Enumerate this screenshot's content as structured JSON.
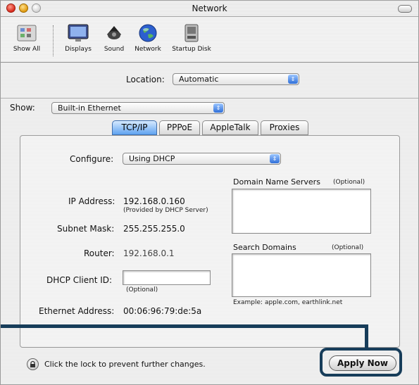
{
  "window": {
    "title": "Network"
  },
  "toolbar": {
    "show_all": "Show All",
    "items": [
      "Displays",
      "Sound",
      "Network",
      "Startup Disk"
    ]
  },
  "location": {
    "label": "Location:",
    "value": "Automatic"
  },
  "show": {
    "label": "Show:",
    "value": "Built-in Ethernet"
  },
  "tabs": [
    "TCP/IP",
    "PPPoE",
    "AppleTalk",
    "Proxies"
  ],
  "tcpip": {
    "configure_label": "Configure:",
    "configure_value": "Using DHCP",
    "ip_label": "IP Address:",
    "ip_value": "192.168.0.160",
    "ip_note": "(Provided by DHCP Server)",
    "subnet_label": "Subnet Mask:",
    "subnet_value": "255.255.255.0",
    "router_label": "Router:",
    "router_value": "192.168.0.1",
    "dhcp_label": "DHCP Client ID:",
    "dhcp_value": "",
    "dhcp_note": "(Optional)",
    "ethernet_label": "Ethernet Address:",
    "ethernet_value": "00:06:96:79:de:5a",
    "dns_label": "Domain Name Servers",
    "dns_optional": "(Optional)",
    "search_label": "Search Domains",
    "search_optional": "(Optional)",
    "example": "Example: apple.com, earthlink.net"
  },
  "footer": {
    "lock_text": "Click the lock to prevent further changes.",
    "apply_label": "Apply Now"
  }
}
